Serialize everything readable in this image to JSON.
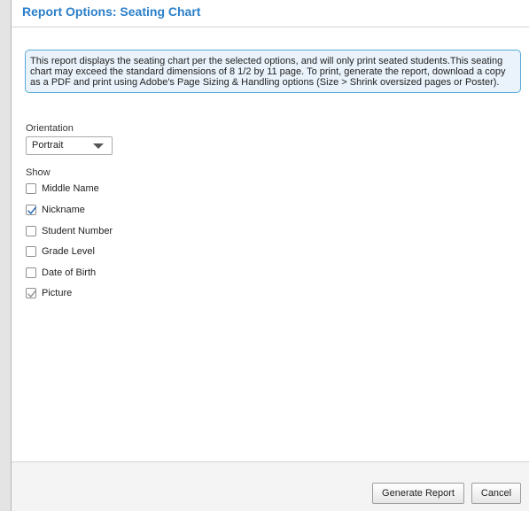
{
  "dialog": {
    "title": "Report Options: Seating Chart",
    "info_text": "This report displays the seating chart per the selected options, and will only print seated students.This seating chart may exceed the standard dimensions of 8 1/2 by 11 page. To print, generate the report, download a copy as a PDF and print using Adobe's Page Sizing & Handling options (Size > Shrink oversized pages or Poster)."
  },
  "orientation": {
    "label": "Orientation",
    "selected": "Portrait"
  },
  "show": {
    "label": "Show",
    "options": [
      {
        "label": "Middle Name",
        "checked": false
      },
      {
        "label": "Nickname",
        "checked": true
      },
      {
        "label": "Student Number",
        "checked": false
      },
      {
        "label": "Grade Level",
        "checked": false
      },
      {
        "label": "Date of Birth",
        "checked": false
      },
      {
        "label": "Picture",
        "checked": true,
        "disabled": true
      }
    ]
  },
  "footer": {
    "generate_label": "Generate Report",
    "cancel_label": "Cancel"
  },
  "colors": {
    "title": "#2a7fc9",
    "info_border": "#58a9d8",
    "info_background": "#eaf3fb",
    "check_active": "#2f6fb5",
    "check_disabled": "#9a9a9a"
  }
}
